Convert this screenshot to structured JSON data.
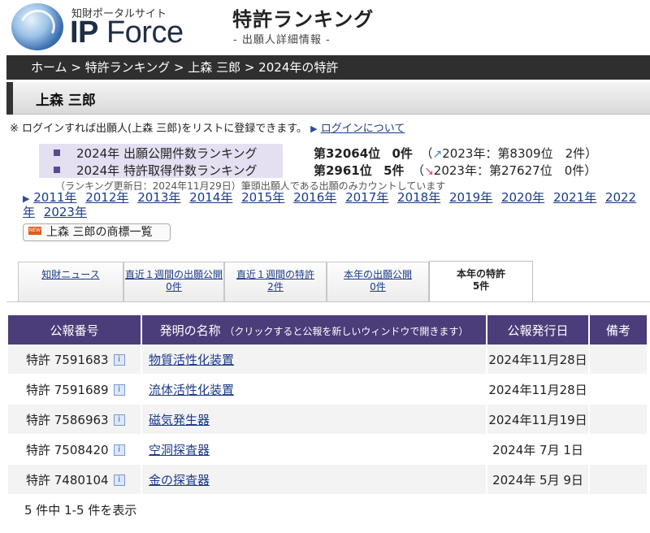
{
  "header": {
    "logo_sub": "知財ポータルサイト",
    "logo_main_bold": "IP",
    "logo_main_rest": " Force",
    "title": "特許ランキング",
    "subtitle": "- 出願人詳細情報 -"
  },
  "breadcrumb": "ホーム > 特許ランキング > 上森 三郎 > 2024年の特許",
  "applicant_name": "上森 三郎",
  "login_note": {
    "text": "※ ログインすれば出願人(上森 三郎)をリストに登録できます。",
    "link": "ログインについて"
  },
  "rankings": [
    {
      "label": "2024年 出願公開件数ランキング",
      "rank": "第32064位",
      "count": "0件",
      "trend": "up",
      "prev": "2023年：第8309位　2件）",
      "open": "（"
    },
    {
      "label": "2024年 特許取得件数ランキング",
      "rank": "第2961位",
      "count": "5件",
      "trend": "down",
      "prev": "2023年：第27627位　0件）",
      "open": "（"
    }
  ],
  "rank_note": "（ランキング更新日：2024年11月29日）筆頭出願人である出願のみカウントしています",
  "years": [
    "2011年",
    "2012年",
    "2013年",
    "2014年",
    "2015年",
    "2016年",
    "2017年",
    "2018年",
    "2019年",
    "2020年",
    "2021年",
    "2022年",
    "2023年"
  ],
  "trademark_button": "上森 三郎の商標一覧",
  "tabs": [
    {
      "line1": "知財ニュース",
      "line2": ""
    },
    {
      "line1": "直近１週間の出願公開",
      "line2": "0件"
    },
    {
      "line1": "直近１週間の特許",
      "line2": "2件"
    },
    {
      "line1": "本年の出願公開",
      "line2": "0件"
    },
    {
      "line1": "本年の特許",
      "line2": "5件"
    }
  ],
  "table": {
    "headers": {
      "number": "公報番号",
      "title": "発明の名称",
      "title_note": "（クリックすると公報を新しいウィンドウで開きます）",
      "date": "公報発行日",
      "remarks": "備考"
    },
    "rows": [
      {
        "number": "特許 7591683",
        "title": "物質活性化装置",
        "date": "2024年11月28日",
        "remarks": ""
      },
      {
        "number": "特許 7591689",
        "title": "流体活性化装置",
        "date": "2024年11月28日",
        "remarks": ""
      },
      {
        "number": "特許 7586963",
        "title": "磁気発生器",
        "date": "2024年11月19日",
        "remarks": ""
      },
      {
        "number": "特許 7508420",
        "title": "空洞探査器",
        "date": "2024年 7月 1日",
        "remarks": ""
      },
      {
        "number": "特許 7480104",
        "title": "金の探査器",
        "date": "2024年 5月 9日",
        "remarks": ""
      }
    ]
  },
  "summary": "5 件中 1-5 件を表示",
  "icons": {
    "info": "i",
    "new_badge": "NEW",
    "trend_up": "↗",
    "trend_down": "↘",
    "link_arrow": "▶"
  }
}
